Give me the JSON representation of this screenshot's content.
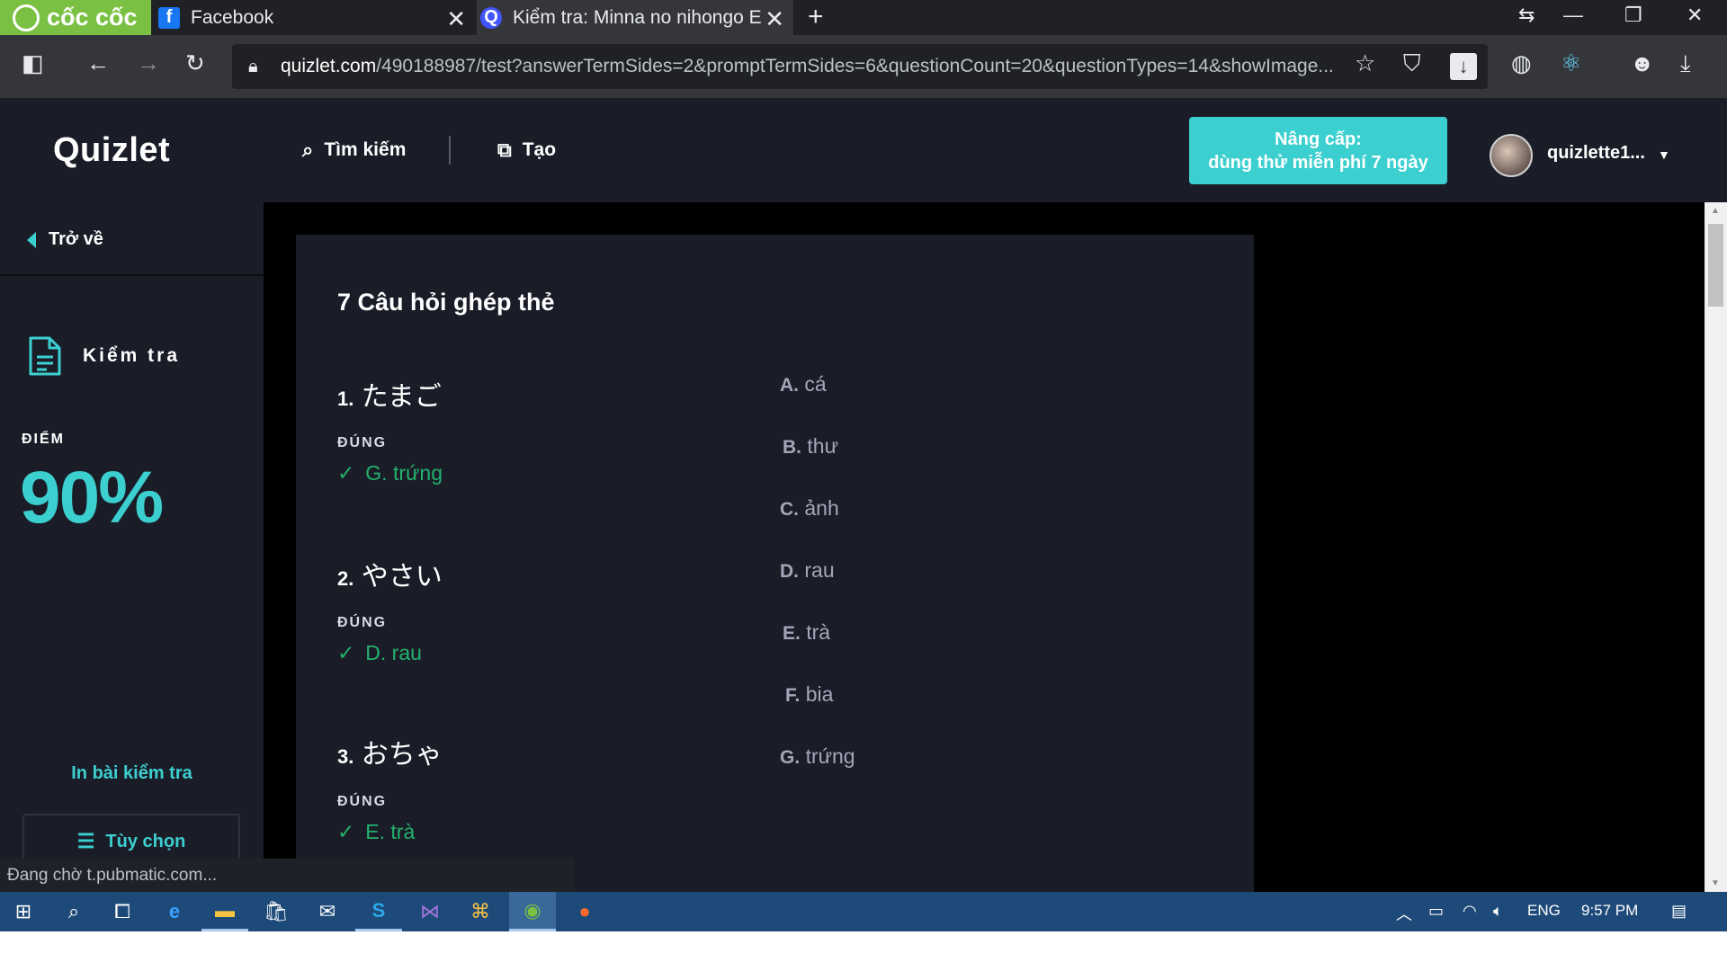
{
  "browser": {
    "brand": "cốc cốc",
    "tabs": [
      {
        "title": "Facebook",
        "icon": "facebook-icon"
      },
      {
        "title": "Kiểm tra: Minna no nihongo E",
        "icon": "quizlet-icon"
      }
    ],
    "url_host": "quizlet.com",
    "url_path": "/490188987/test?answerTermSides=2&promptTermSides=6&questionCount=20&questionTypes=14&showImage..."
  },
  "header": {
    "logo": "Quizlet",
    "search_label": "Tìm kiếm",
    "create_label": "Tạo",
    "upgrade_line1": "Nâng cấp:",
    "upgrade_line2": "dùng thử miễn phí 7 ngày",
    "username": "quizlette1..."
  },
  "sidebar": {
    "back_label": "Trở về",
    "mode_label": "Kiểm tra",
    "score_label": "ĐIỂM",
    "score_value": "90%",
    "print_label": "In bài kiểm tra",
    "options_label": "Tùy chọn"
  },
  "section": {
    "title": "7 Câu hỏi ghép thẻ",
    "questions": [
      {
        "num": "1.",
        "term": "たまご",
        "status": "ĐÚNG",
        "answer": "G. trứng"
      },
      {
        "num": "2.",
        "term": "やさい",
        "status": "ĐÚNG",
        "answer": "D. rau"
      },
      {
        "num": "3.",
        "term": "おちゃ",
        "status": "ĐÚNG",
        "answer": "E. trà"
      }
    ],
    "choices": [
      {
        "letter": "A.",
        "text": "cá"
      },
      {
        "letter": "B.",
        "text": "thư"
      },
      {
        "letter": "C.",
        "text": "ảnh"
      },
      {
        "letter": "D.",
        "text": "rau"
      },
      {
        "letter": "E.",
        "text": "trà"
      },
      {
        "letter": "F.",
        "text": "bia"
      },
      {
        "letter": "G.",
        "text": "trứng"
      }
    ]
  },
  "status_text": "Đang chờ t.pubmatic.com...",
  "taskbar": {
    "language": "ENG",
    "time": "9:57 PM"
  },
  "colors": {
    "accent": "#3ccfcf",
    "correct": "#23b26d",
    "panel": "#1a1d28",
    "brand_green": "#7ac143"
  }
}
